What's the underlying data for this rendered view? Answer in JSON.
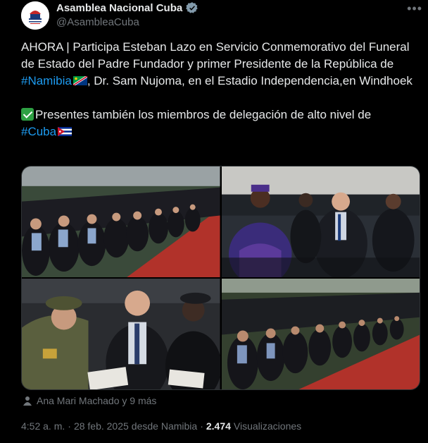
{
  "account": {
    "display_name": "Asamblea Nacional Cuba",
    "handle": "@AsambleaCuba",
    "avatar_icon": "parliament-logo-icon",
    "verified_icon": "verified-badge-icon"
  },
  "menu_icon": "more-options-icon",
  "post": {
    "line1_prefix": "AHORA | Participa Esteban Lazo en Servicio Conmemorativo del Funeral de Estado del Padre Fundador y primer Presidente de la República de ",
    "hashtag_namibia": "#Namibia",
    "line1_suffix": ", Dr. Sam Nujoma, en el Estadio Independencia,en Windhoek",
    "line2_prefix": "Presentes también los miembros de delegación de alto nivel de ",
    "hashtag_cuba": "#Cuba"
  },
  "photos": [
    {
      "name": "photo-delegation-rows"
    },
    {
      "name": "photo-delegation-seated"
    },
    {
      "name": "photo-delegation-closeup"
    },
    {
      "name": "photo-stadium-rows"
    }
  ],
  "tagged": {
    "icon": "person-icon",
    "text": "Ana Mari Machado y 9 más"
  },
  "meta": {
    "time": "4:52 a. m.",
    "separator": "·",
    "date": "28 feb. 2025",
    "source": "desde Namibia",
    "views_count": "2.474",
    "views_label": "Visualizaciones"
  },
  "colors": {
    "background": "#000000",
    "text": "#e7e9ea",
    "muted": "#71767b",
    "link": "#1d9bf0",
    "verified": "#1d9bf0"
  }
}
